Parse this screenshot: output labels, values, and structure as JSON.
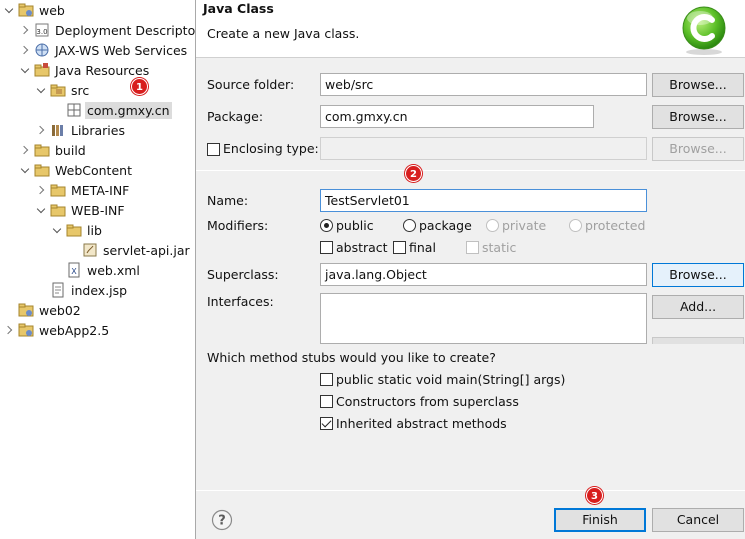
{
  "tree": {
    "items": [
      {
        "label": "web",
        "depth": 0,
        "arrow": "open",
        "icon": "project-icon"
      },
      {
        "label": "Deployment Descriptor:",
        "depth": 1,
        "arrow": "closed",
        "icon": "deployment-descriptor-icon"
      },
      {
        "label": "JAX-WS Web Services",
        "depth": 1,
        "arrow": "closed",
        "icon": "web-services-icon"
      },
      {
        "label": "Java Resources",
        "depth": 1,
        "arrow": "open",
        "icon": "java-resources-icon"
      },
      {
        "label": "src",
        "depth": 2,
        "arrow": "open",
        "icon": "source-folder-icon"
      },
      {
        "label": "com.gmxy.cn",
        "depth": 3,
        "arrow": "none",
        "icon": "package-icon",
        "selected": true
      },
      {
        "label": "Libraries",
        "depth": 2,
        "arrow": "closed",
        "icon": "libraries-icon"
      },
      {
        "label": "build",
        "depth": 1,
        "arrow": "closed",
        "icon": "folder-icon"
      },
      {
        "label": "WebContent",
        "depth": 1,
        "arrow": "open",
        "icon": "folder-icon"
      },
      {
        "label": "META-INF",
        "depth": 2,
        "arrow": "closed",
        "icon": "folder-icon"
      },
      {
        "label": "WEB-INF",
        "depth": 2,
        "arrow": "open",
        "icon": "folder-icon"
      },
      {
        "label": "lib",
        "depth": 3,
        "arrow": "open",
        "icon": "folder-icon"
      },
      {
        "label": "servlet-api.jar",
        "depth": 4,
        "arrow": "none",
        "icon": "jar-icon"
      },
      {
        "label": "web.xml",
        "depth": 3,
        "arrow": "none",
        "icon": "xml-file-icon"
      },
      {
        "label": "index.jsp",
        "depth": 2,
        "arrow": "none",
        "icon": "jsp-file-icon"
      },
      {
        "label": "web02",
        "depth": 0,
        "arrow": "none",
        "icon": "project-icon"
      },
      {
        "label": "webApp2.5",
        "depth": 0,
        "arrow": "closed",
        "icon": "project-icon"
      }
    ]
  },
  "dialog": {
    "title": "Java Class",
    "description": "Create a new Java class.",
    "source_folder": {
      "label": "Source folder:",
      "value": "web/src",
      "browse": "Browse..."
    },
    "package": {
      "label": "Package:",
      "value": "com.gmxy.cn",
      "browse": "Browse..."
    },
    "enclosing": {
      "label": "Enclosing type:",
      "value": "",
      "browse": "Browse...",
      "checked": false
    },
    "name": {
      "label": "Name:",
      "value": "TestServlet01"
    },
    "modifiers": {
      "label": "Modifiers:",
      "access": [
        {
          "label": "public",
          "checked": true,
          "enabled": true
        },
        {
          "label": "package",
          "checked": false,
          "enabled": true
        },
        {
          "label": "private",
          "checked": false,
          "enabled": false
        },
        {
          "label": "protected",
          "checked": false,
          "enabled": false
        }
      ],
      "flags": [
        {
          "label": "abstract",
          "checked": false,
          "enabled": true
        },
        {
          "label": "final",
          "checked": false,
          "enabled": true
        },
        {
          "label": "static",
          "checked": false,
          "enabled": false
        }
      ]
    },
    "superclass": {
      "label": "Superclass:",
      "value": "java.lang.Object",
      "browse": "Browse..."
    },
    "interfaces": {
      "label": "Interfaces:",
      "add": "Add..."
    },
    "stubs": {
      "question": "Which method stubs would you like to create?",
      "options": [
        {
          "label": "public static void main(String[] args)",
          "checked": false
        },
        {
          "label": "Constructors from superclass",
          "checked": false
        },
        {
          "label": "Inherited abstract methods",
          "checked": true
        }
      ]
    },
    "finish_label": "Finish",
    "cancel_label": "Cancel"
  },
  "annotations": {
    "badge1": "1",
    "badge2": "2",
    "badge3": "3"
  },
  "colors": {
    "badge": "#d81e1e",
    "accent": "#0078d7",
    "dialog_bg": "#f0f0f0"
  }
}
